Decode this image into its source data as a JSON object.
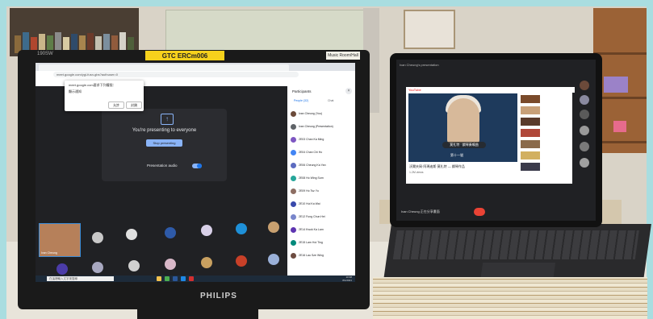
{
  "monitor": {
    "model_label": "190SW",
    "sticker_label": "GTC  ERCm006",
    "sticker_white": "Music Room/Hall",
    "brand": "PHILIPS"
  },
  "browser": {
    "address": "meet.google.com/ygi-fusn-gbs?authuser=0",
    "popup_title": "meet.google.com要求下列權限：",
    "popup_permission": "顯示通知",
    "popup_allow": "允許",
    "popup_block": "封鎖",
    "notification_bar": "已在畫面上共享分頁"
  },
  "meet": {
    "presenting_text": "You're presenting to everyone",
    "stop_button": "Stop presenting",
    "audio_label": "Presentation audio",
    "camera_name": "Ivan Cheung",
    "panel_title": "Participants",
    "tab_people": "People (32)",
    "tab_chat": "Chat",
    "participants": [
      "Ivan Cheung (You)",
      "Ivan Cheung (Presentation)",
      "2E03 Chan Ka Ming",
      "2E04 Chan Chi Ho",
      "2E06 Cheung Ka Yan",
      "2E08 Ho Wing Sum",
      "2E09 Ho Tsz Yu",
      "2E10 Hui Ka Wai",
      "2E12 Fung Chun Hei",
      "2E14 Kwok Ka Lam",
      "2E15 Lam Hoi Ting",
      "2E16 Lau Sze Wing"
    ]
  },
  "taskbar": {
    "search_placeholder": "在這裡輸入文字來搜尋",
    "time": "10:38",
    "date": "8/1/2021"
  },
  "tablet": {
    "top_text": "Ivan Cheung's presentation",
    "yt_logo": "YouTube",
    "caption_1": "莫扎特 · 鋼琴奏鳴曲",
    "caption_2": "第十一號",
    "video_title": "沃爾夫岡·阿瑪迪斯·莫扎特 — 鋼琴作品",
    "video_sub": "1.2M views",
    "bottom_name": "Ivan Cheung 正在分享畫面"
  },
  "colors": {
    "meet_blue": "#8ab4f8",
    "sticker": "#f6d11c",
    "end_call": "#ea4335"
  }
}
